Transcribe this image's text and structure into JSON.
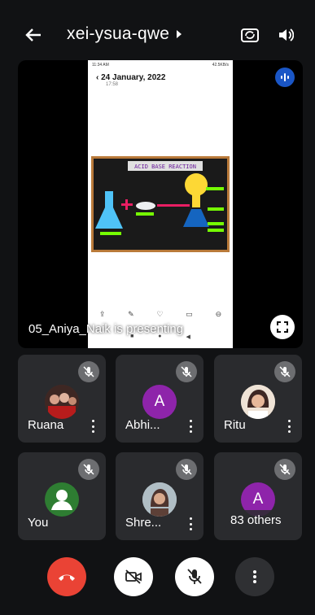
{
  "header": {
    "meeting_code": "xei-ysua-qwe",
    "icons": [
      "back-arrow-icon",
      "chevron-right-icon",
      "switch-camera-icon",
      "speaker-icon"
    ]
  },
  "stage": {
    "presenting_text": "05_Aniya_Naik is presenting",
    "shared_screen": {
      "status_left": "11:34 AM",
      "status_right": "42.5KB/s",
      "date": "24 January, 2022",
      "time": "17:58",
      "poster_title": "ACID BASE REACTION"
    }
  },
  "participants": [
    {
      "name": "Ruana",
      "avatar_type": "photo"
    },
    {
      "name": "Abhi...",
      "avatar_type": "initial",
      "initial": "A",
      "color": "#8e24aa"
    },
    {
      "name": "Ritu",
      "avatar_type": "photo"
    },
    {
      "name": "You",
      "avatar_type": "default",
      "color": "#2e7d32"
    },
    {
      "name": "Shre...",
      "avatar_type": "photo"
    },
    {
      "name": "",
      "avatar_type": "initial",
      "initial": "A",
      "color": "#8e24aa",
      "others_label": "83 others"
    }
  ],
  "controls": {
    "end_call_color": "#ea4335",
    "icons": [
      "end-call-icon",
      "camera-off-icon",
      "mic-off-icon",
      "more-options-icon"
    ]
  }
}
